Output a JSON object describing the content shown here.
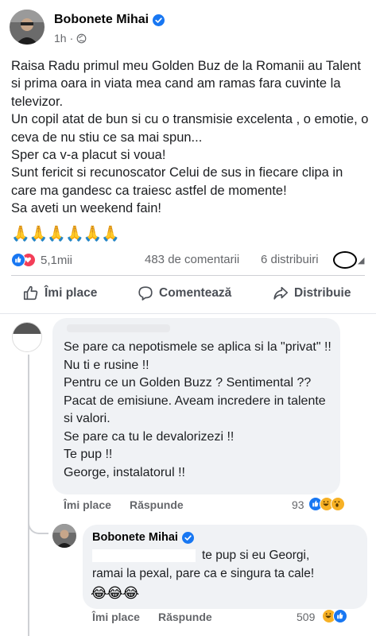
{
  "post": {
    "author": "Bobonete Mihai",
    "time": "1h",
    "privacy_separator": "·",
    "paragraphs": [
      "Raisa Radu primul meu Golden Buz de la Romanii au Talent si prima oara in viata mea cand am ramas fara cuvinte la televizor.",
      "Un copil atat de bun si cu o transmisie excelenta , o emotie, o ceva de nu stiu ce sa mai spun...",
      "Sper ca v-a placut si voua!",
      "Sunt fericit si recunoscator Celui de sus in fiecare clipa in care ma gandesc ca traiesc astfel de momente!",
      "Sa aveti un weekend fain!"
    ],
    "emoji_line": "🙏🙏🙏🙏🙏🙏"
  },
  "stats": {
    "reaction_count": "5,1mii",
    "comments": "483 de comentarii",
    "shares": "6 distribuiri"
  },
  "actions": {
    "like": "Îmi place",
    "comment": "Comentează",
    "share": "Distribuie"
  },
  "comment1": {
    "lines": [
      "Se pare ca nepotismele se aplica si la \"privat\" !!",
      "Nu ti e rusine !!",
      "Pentru ce un Golden Buzz ? Sentimental ??",
      "Pacat de emisiune. Aveam incredere in talente si valori.",
      "Se pare ca tu le devalorizezi !!",
      "Te pup !!",
      "George, instalatorul !!"
    ],
    "like_label": "Îmi place",
    "reply_label": "Răspunde",
    "reaction_count": "93"
  },
  "comment2": {
    "author": "Bobonete Mihai",
    "line1": "te pup si eu Georgi,",
    "line2": "ramai la pexal, pare ca e singura ta cale!",
    "emojis": "😂😂😂",
    "like_label": "Îmi place",
    "reply_label": "Răspunde",
    "reaction_count": "509"
  },
  "colors": {
    "facebook_blue": "#1877f2",
    "love_red": "#f33e58",
    "haha_yellow": "#f7b125",
    "secondary_text": "#65676b",
    "bubble_bg": "#f0f2f5"
  }
}
